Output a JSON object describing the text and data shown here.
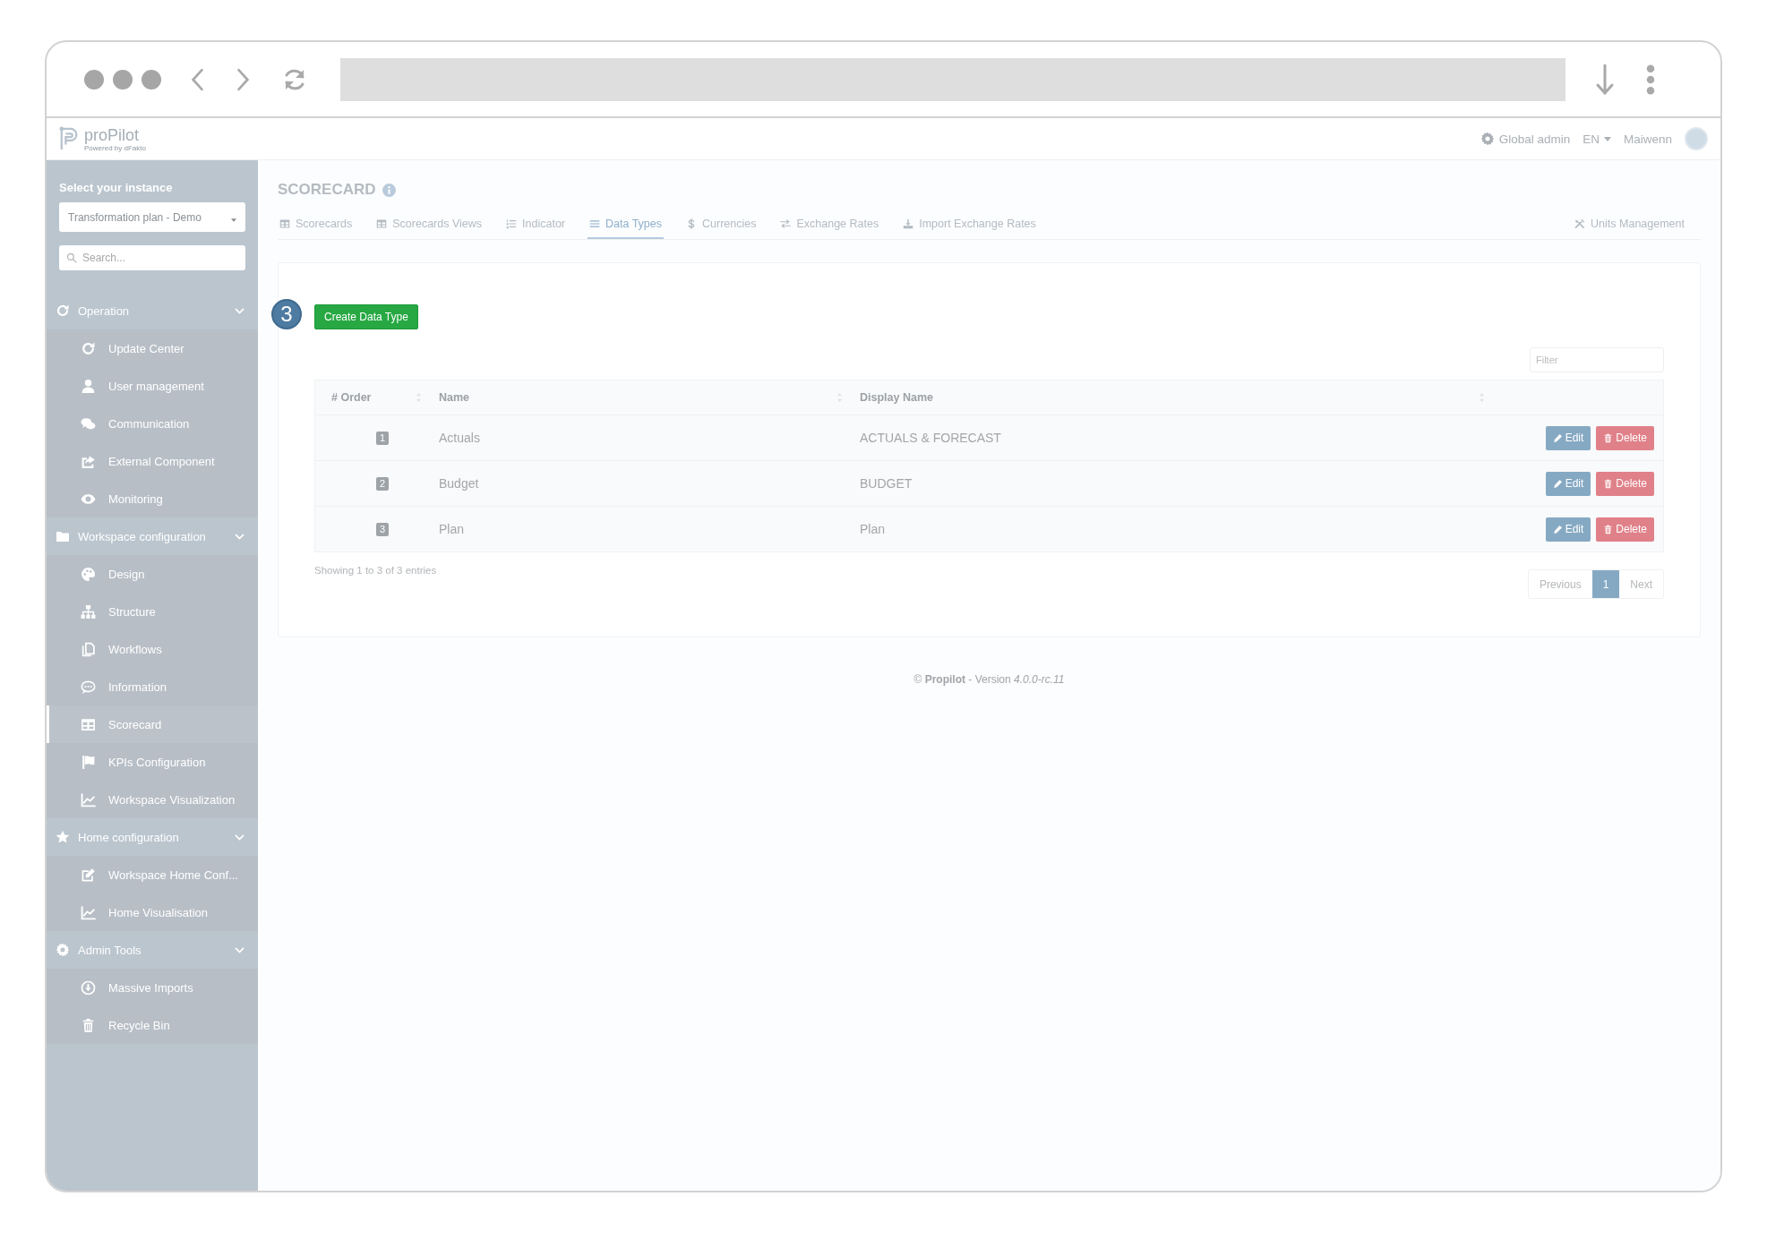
{
  "header": {
    "logo": "proPilot",
    "logo_tagline": "Powered by dFakto",
    "admin_link": "Global admin",
    "language": "EN",
    "user": "Maiwenn"
  },
  "sidebar": {
    "instance_label": "Select your instance",
    "instance_value": "Transformation plan - Demo",
    "search_placeholder": "Search...",
    "sections": [
      {
        "label": "Operation",
        "expanded": true,
        "children": [
          {
            "label": "Update Center",
            "selected": false
          },
          {
            "label": "User management",
            "selected": false
          },
          {
            "label": "Communication",
            "selected": false
          },
          {
            "label": "External Component",
            "selected": false
          },
          {
            "label": "Monitoring",
            "selected": false
          }
        ]
      },
      {
        "label": "Workspace configuration",
        "expanded": true,
        "children": [
          {
            "label": "Design",
            "selected": false
          },
          {
            "label": "Structure",
            "selected": false
          },
          {
            "label": "Workflows",
            "selected": false
          },
          {
            "label": "Information",
            "selected": false
          },
          {
            "label": "Scorecard",
            "selected": true
          },
          {
            "label": "KPIs Configuration",
            "selected": false
          },
          {
            "label": "Workspace Visualization",
            "selected": false
          }
        ]
      },
      {
        "label": "Home configuration",
        "expanded": true,
        "children": [
          {
            "label": "Workspace Home Conf...",
            "selected": false
          },
          {
            "label": "Home Visualisation",
            "selected": false
          }
        ]
      },
      {
        "label": "Admin Tools",
        "expanded": true,
        "children": [
          {
            "label": "Massive Imports",
            "selected": false
          },
          {
            "label": "Recycle Bin",
            "selected": false
          }
        ]
      }
    ]
  },
  "page": {
    "title": "SCORECARD",
    "tabs": [
      {
        "label": "Scorecards",
        "selected": false
      },
      {
        "label": "Scorecards Views",
        "selected": false
      },
      {
        "label": "Indicator",
        "selected": false
      },
      {
        "label": "Data Types",
        "selected": true
      },
      {
        "label": "Currencies",
        "selected": false
      },
      {
        "label": "Exchange Rates",
        "selected": false
      },
      {
        "label": "Import Exchange Rates",
        "selected": false
      },
      {
        "label": "Units Management",
        "selected": false
      }
    ],
    "step_marker": "3",
    "create_button": "Create Data Type",
    "filter_placeholder": "Filter",
    "table": {
      "columns": [
        "# Order",
        "Name",
        "Display Name"
      ],
      "rows": [
        {
          "order": "1",
          "name": "Actuals",
          "display_name": "ACTUALS & FORECAST",
          "actions": [
            {
              "kind": "edit",
              "label": "Edit"
            },
            {
              "kind": "delete",
              "label": "Delete"
            }
          ]
        },
        {
          "order": "2",
          "name": "Budget",
          "display_name": "BUDGET",
          "actions": [
            {
              "kind": "edit",
              "label": "Edit"
            },
            {
              "kind": "delete",
              "label": "Delete"
            }
          ]
        },
        {
          "order": "3",
          "name": "Plan",
          "display_name": "Plan",
          "actions": [
            {
              "kind": "edit",
              "label": "Edit"
            },
            {
              "kind": "delete",
              "label": "Delete"
            }
          ]
        }
      ]
    },
    "info": "Showing 1 to 3 of 3 entries",
    "pagination": [
      {
        "label": "Previous",
        "selected": false,
        "disabled": true
      },
      {
        "label": "1",
        "selected": true,
        "disabled": false
      },
      {
        "label": "Next",
        "selected": false,
        "disabled": true
      }
    ],
    "footer": "© **Propilot** - Version *4.0.0-rc.11*"
  }
}
